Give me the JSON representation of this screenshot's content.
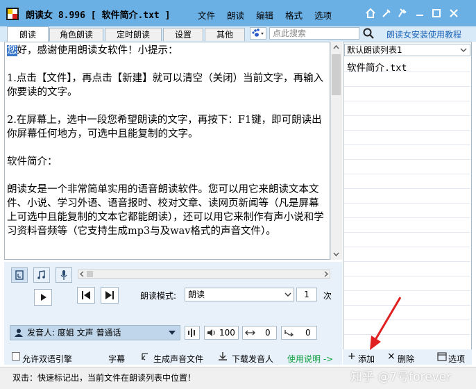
{
  "window": {
    "title": "朗读女 8.996 [ 软件简介.txt ]",
    "menu": [
      "文件",
      "朗读",
      "编辑",
      "格式",
      "选项"
    ],
    "title_icons": [
      "home-icon",
      "tools-icon",
      "pin-icon",
      "minimize-icon",
      "maximize-icon",
      "close-icon"
    ]
  },
  "tabs": [
    "朗读",
    "角色朗读",
    "定时朗读",
    "设置",
    "其他"
  ],
  "search": {
    "placeholder": "点此搜索"
  },
  "tutorial_link": "朗读女安装使用教程",
  "editor": {
    "highlight": "您",
    "paragraphs": [
      "好，感谢使用朗读女软件！小提示：",
      "1.点击【文件】，再点击【新建】就可以清空（关闭）当前文字，再输入你要读的文字。",
      "2.在屏幕上，选中一段您希望朗读的文字，再按下：F1键，即可朗读出你屏幕任何地方，可选中且能复制的文字。",
      "软件简介：",
      "朗读女是一个非常简单实用的语音朗读软件。您可以用它来朗读文本文件、小说、学习外语、语音报时、校对文章、读网页新闻等（凡是屏幕上可选中且能复制的文本它都能朗读），还可以用它来制作有声小说和学习资料音频等（它支持生成mp3与及wav格式的声音文件）。"
    ]
  },
  "controls": {
    "mode_label": "朗读模式:",
    "mode_value": "朗读",
    "count_value": "1",
    "count_unit": "次",
    "voice": "发音人: 度姐 文声 普通话",
    "volume": "100",
    "speed": "0",
    "pitch": "0",
    "bilingual": "允许双语引擎",
    "subtitle": "字幕",
    "generate_audio": "生成声音文件",
    "download_voice": "下载发音人",
    "help": "使用说明 ->"
  },
  "playlist": {
    "name": "默认朗读列表1",
    "items": [
      "软件简介.txt"
    ],
    "add": "添加",
    "delete": "删除",
    "options": "选项"
  },
  "status": "双击：快速标记出，当前文件在朗读列表中位置！",
  "watermark": "知乎 @7号forever",
  "colors": {
    "titlebar": "#6bb0e4",
    "panel": "#e8f1fa",
    "link": "#1a64b8",
    "arrow": "#e02020"
  }
}
